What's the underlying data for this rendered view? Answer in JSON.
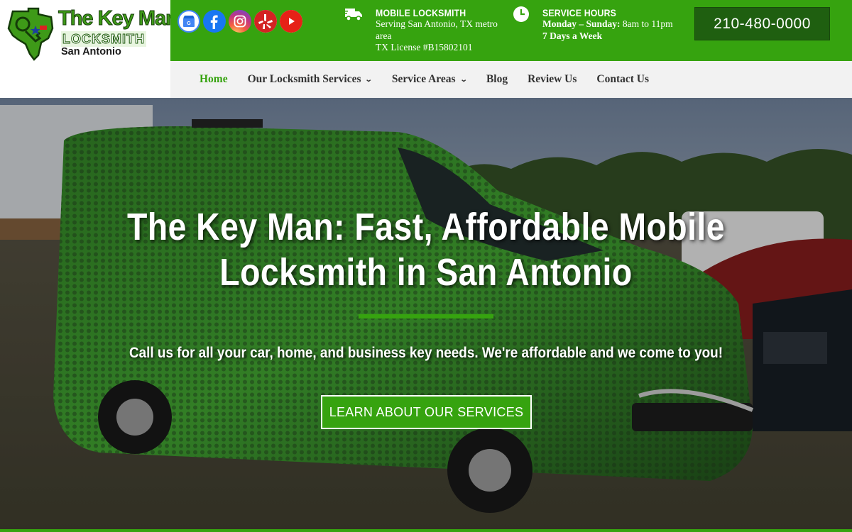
{
  "brand": {
    "line1": "The Key Man",
    "line2": "LOCKSMITH",
    "line3": "San Antonio"
  },
  "social": [
    {
      "name": "google-business-icon"
    },
    {
      "name": "facebook-icon"
    },
    {
      "name": "instagram-icon"
    },
    {
      "name": "yelp-icon"
    },
    {
      "name": "youtube-icon"
    }
  ],
  "mobile": {
    "icon": "truck-icon",
    "title": "MOBILE LOCKSMITH",
    "line1": "Serving San Antonio, TX metro",
    "line2": "area",
    "line3": "TX License #B15802101"
  },
  "hours": {
    "icon": "clock-icon",
    "title": "SERVICE HOURS",
    "days_label": "Monday – Sunday:",
    "days_time": " 8am to 11pm",
    "week": "7 Days a Week"
  },
  "phone": "210-480-0000",
  "nav": {
    "home": "Home",
    "services": "Our Locksmith Services",
    "areas": "Service Areas",
    "blog": "Blog",
    "review": "Review Us",
    "contact": "Contact Us"
  },
  "hero": {
    "title_line1": "The Key Man: Fast, Affordable Mobile",
    "title_line2": "Locksmith in San Antonio",
    "subtitle": "Call us for all your car, home, and business key needs. We're affordable and we come to you!",
    "cta": "LEARN ABOUT OUR SERVICES"
  },
  "colors": {
    "brand_green": "#36a30f",
    "dark_green": "#1f5f10",
    "nav_bg": "#f2f2f2"
  }
}
